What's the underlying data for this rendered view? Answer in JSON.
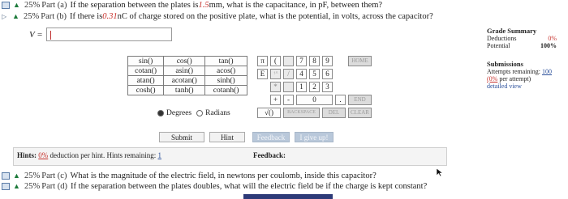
{
  "parts": {
    "a": {
      "percent": "25%",
      "part": "Part (a)",
      "text_before": "If the separation between the plates is ",
      "value": "1.5",
      "text_after": " mm, what is the capacitance, in pF, between them?"
    },
    "b": {
      "percent": "25%",
      "part": "Part (b)",
      "text_before": "If there is ",
      "value": "0.31",
      "text_after": " nC of charge stored on the positive plate, what is the potential, in volts, across the capacitor?"
    },
    "c": {
      "percent": "25%",
      "part": "Part (c)",
      "text": "What is the magnitude of the electric field, in newtons per coulomb, inside this capacitor?"
    },
    "d": {
      "percent": "25%",
      "part": "Part (d)",
      "text": "If the separation between the plates doubles, what will the electric field be if the charge is kept constant?"
    }
  },
  "answer": {
    "label": "V =",
    "value": ""
  },
  "calculator": {
    "functions": [
      [
        "sin()",
        "cos()",
        "tan()"
      ],
      [
        "cotan()",
        "asin()",
        "acos()"
      ],
      [
        "atan()",
        "acotan()",
        "sinh()"
      ],
      [
        "cosh()",
        "tanh()",
        "cotanh()"
      ]
    ],
    "degrees": "Degrees",
    "radians": "Radians",
    "pi": "π",
    "open_paren": "(",
    "e": "E",
    "caret": "↑^",
    "slash": "/",
    "star": "*",
    "plus": "+",
    "minus": "-",
    "sqrt": "√()",
    "digits": [
      "7",
      "8",
      "9",
      "4",
      "5",
      "6",
      "1",
      "2",
      "3",
      "0"
    ],
    "dot": ".",
    "home": "HOME",
    "end": "END",
    "backspace": "BACKSPACE",
    "del": "DEL",
    "clear": "CLEAR"
  },
  "buttons": {
    "submit": "Submit",
    "hint": "Hint",
    "feedback": "Feedback",
    "giveup": "I give up!"
  },
  "hints": {
    "label": "Hints:",
    "pct": "0%",
    "text": " deduction per hint. Hints remaining: ",
    "remaining": "1"
  },
  "feedback": {
    "label": "Feedback:"
  },
  "grade_summary": {
    "title": "Grade Summary",
    "deductions_label": "Deductions",
    "deductions_value": "0%",
    "potential_label": "Potential",
    "potential_value": "100%",
    "submissions_title": "Submissions",
    "attempts_label": "Attempts remaining: ",
    "attempts_value": "100",
    "per_attempt_pct": "(0%",
    "per_attempt_text": " per attempt)",
    "detailed_view": "detailed view"
  },
  "colors": {
    "accent_red": "#c7302b",
    "link_blue": "#2a4f9a",
    "disabled_button": "#b9c8da"
  }
}
